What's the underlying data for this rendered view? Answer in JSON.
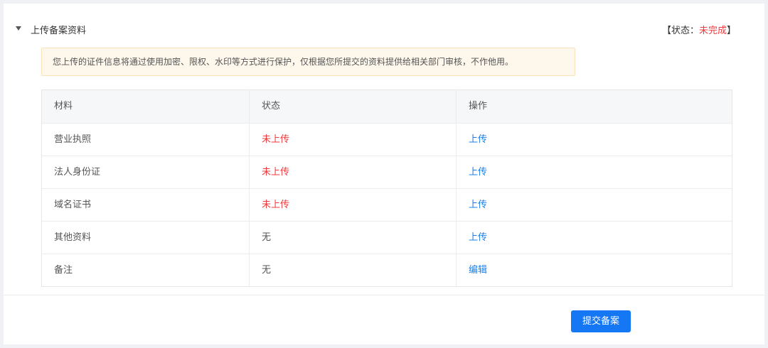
{
  "section": {
    "title": "上传备案资料",
    "status_prefix": "【状态：",
    "status_value": "未完成",
    "status_suffix": "】",
    "status_color": "#f2393c"
  },
  "notice": {
    "text": "您上传的证件信息将通过使用加密、限权、水印等方式进行保护，仅根据您所提交的资料提供给相关部门审核，不作他用。"
  },
  "table": {
    "headers": [
      "材料",
      "状态",
      "操作"
    ],
    "rows": [
      {
        "material": "营业执照",
        "status": "未上传",
        "action": "上传"
      },
      {
        "material": "法人身份证",
        "status": "未上传",
        "action": "上传"
      },
      {
        "material": "域名证书",
        "status": "未上传",
        "action": "上传"
      },
      {
        "material": "其他资料",
        "status": "无",
        "action": "上传"
      },
      {
        "material": "备注",
        "status": "无",
        "action": "编辑"
      }
    ]
  },
  "footer": {
    "submit_label": "提交备案",
    "accent_color": "#1677f5"
  }
}
